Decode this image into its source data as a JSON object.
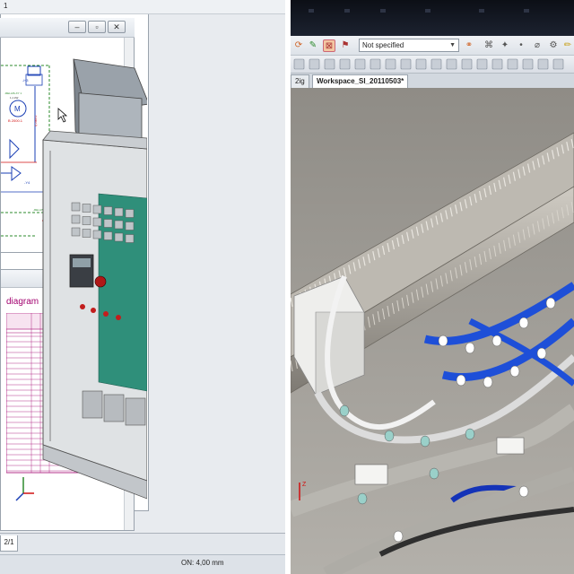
{
  "left": {
    "view3d_tab": "1",
    "page_tab": "2/1",
    "status": "ON: 4,00 mm",
    "schematic": {
      "cursor": "mouse-pointer",
      "labels": [
        "-H3",
        "-M3",
        "-Y4",
        "-M1"
      ]
    },
    "diagram": {
      "title": "diagram"
    }
  },
  "right": {
    "toolbar": {
      "dropdown_value": "Not specified"
    },
    "tabs": [
      {
        "label": "2ig",
        "active": false
      },
      {
        "label": "Workspace_SI_20110503*",
        "active": true
      }
    ]
  },
  "colors": {
    "schematic_blue": "#1a3fb5",
    "schematic_red": "#d01010",
    "schematic_green": "#2e8b2e",
    "diagram_magenta": "#a2006f",
    "cabinet_teal": "#2f8f7a",
    "harness_blue": "#1e4fd8",
    "harness_white": "#f2f2f2"
  }
}
